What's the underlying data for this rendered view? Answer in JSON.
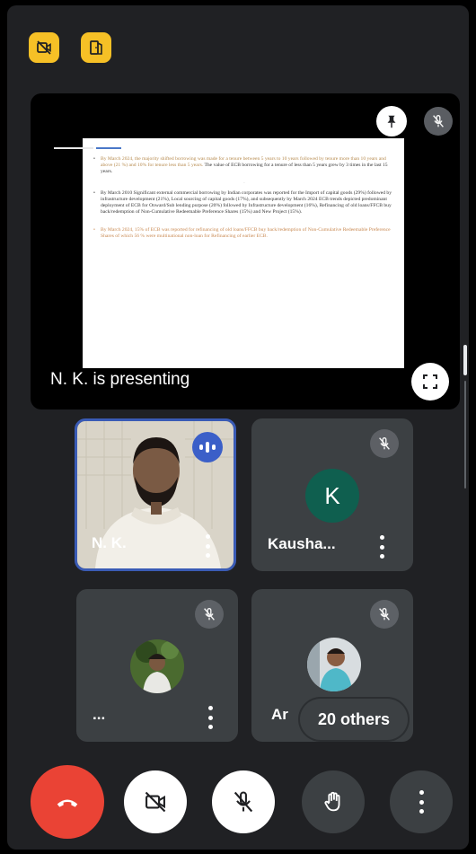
{
  "presentation": {
    "label": "N. K. is presenting",
    "doc_toolbar": [
      "",
      "",
      "",
      ""
    ],
    "doc_bullets": [
      {
        "style": "mixed",
        "highlight": "By March 2024, the majority shifted borrowing was made for a tenure between 5 years to 10 years followed by tenure more than 10 years and above (21 %) and 10% for tenure less than 5 years.",
        "text": " The value of ECB borrowing for a tenure of less than 5 years grew by 3 times in the last 15 years."
      },
      {
        "style": "plain",
        "highlight": "",
        "text": "By March 2010 Significant external commercial borrowing by Indian corporates was reported for the Import of capital goods (29%) followed by infrastructure development (21%), Local sourcing of capital goods (17%), and subsequently by March 2024 ECB trends depicted predominant deployment of ECB for Onward/Sub lending purpose (20%) followed by Infrastructure development (16%), Refinancing of old loans/FFCB buy back/redemption of Non-Cumulative Redeemable Preference Shares (15%) and New Project (15%)."
      },
      {
        "style": "orange",
        "highlight": "",
        "text": "By March 2024, 15% of ECB was reported for refinancing of old loans/FFCB buy back/redemption of Non-Cumulative Redeemable Preference Shares of which 56 % were multinational non-loan for Refinancing of earlier ECB."
      }
    ]
  },
  "participants": [
    {
      "name": "N. K.",
      "type": "video",
      "speaking": true
    },
    {
      "name": "Kausha...",
      "type": "initial",
      "initial": "K",
      "avatar_color": "#0f5f4f",
      "muted": true
    },
    {
      "name": "...",
      "type": "photo",
      "muted": true
    },
    {
      "name": "Ar",
      "type": "photo",
      "muted": true
    }
  ],
  "others_label": "20 others",
  "icons": {
    "top_left_1": "camera-off-icon",
    "top_left_2": "switch-camera-icon",
    "pin": "pin-icon",
    "mute": "mic-off-icon",
    "fullscreen": "fullscreen-icon",
    "end_call": "end-call-icon",
    "camera": "camera-off-icon",
    "mic": "mic-off-icon",
    "hand": "raise-hand-icon",
    "more": "more-vert-icon"
  },
  "colors": {
    "background": "#202124",
    "tile": "#3c4043",
    "accent_yellow": "#f6c026",
    "end_call": "#ea4335",
    "active_border": "#3a5bb5"
  }
}
